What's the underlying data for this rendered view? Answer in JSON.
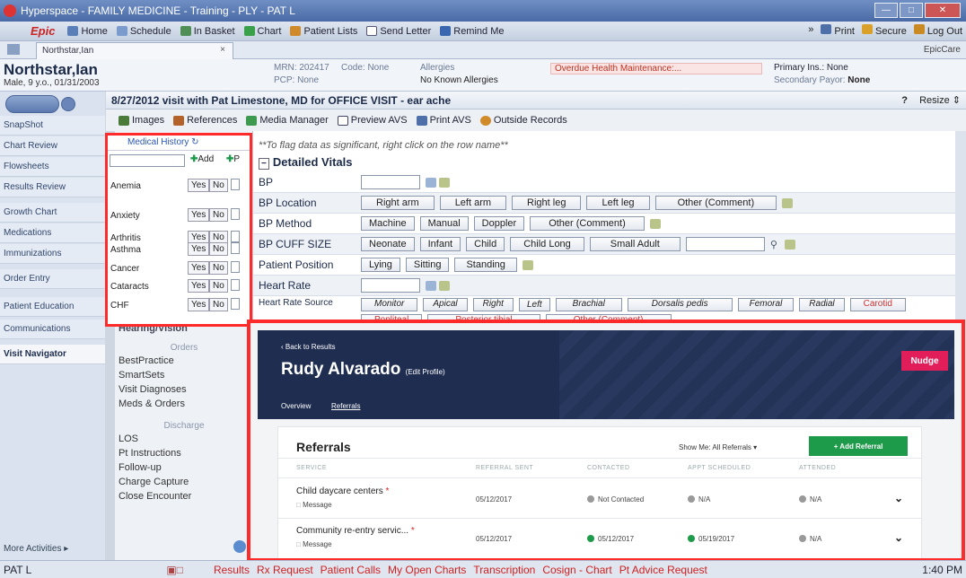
{
  "window": {
    "title": "Hyperspace - FAMILY MEDICINE - Training - PLY - PAT L"
  },
  "toolbar": {
    "brand": "Epic",
    "items": [
      "Home",
      "Schedule",
      "In Basket",
      "Chart",
      "Patient Lists",
      "Send Letter",
      "Remind Me"
    ],
    "right_items": [
      "Print",
      "Secure",
      "Log Out"
    ]
  },
  "patient_tab": {
    "label": "Northstar,Ian",
    "close": "×",
    "app_label": "EpicCare"
  },
  "patient": {
    "name": "Northstar,Ian",
    "sub": "Male, 9 y.o., 01/31/2003",
    "mrn_label": "MRN: 202417",
    "code_label": "Code: None",
    "pcp_label": "PCP: None",
    "allergies_label": "Allergies",
    "allergies_value": "No Known Allergies",
    "overdue": "Overdue Health Maintenance:...",
    "primary_ins": "Primary Ins.: None",
    "secondary_payor_label": "Secondary Payor:",
    "secondary_payor_value": "None"
  },
  "visit": {
    "title": "8/27/2012 visit with Pat Limestone, MD for OFFICE VISIT - ear ache",
    "help": "?",
    "resize": "Resize ⇕",
    "tools": [
      "Images",
      "References",
      "Media Manager",
      "Preview AVS",
      "Print AVS",
      "Outside Records"
    ]
  },
  "nav": {
    "items": [
      "SnapShot",
      "Chart Review",
      "Flowsheets",
      "Results Review",
      "Growth Chart",
      "Medications",
      "Immunizations",
      "Order Entry",
      "Patient Education",
      "Communications",
      "Visit Navigator"
    ],
    "more": "More Activities ▸"
  },
  "mid": {
    "hearing": "Hearing/Vision",
    "orders_head": "Orders",
    "orders": [
      "BestPractice",
      "SmartSets",
      "Visit Diagnoses",
      "Meds & Orders"
    ],
    "discharge_head": "Discharge",
    "discharge": [
      "LOS",
      "Pt Instructions",
      "Follow-up",
      "Charge Capture",
      "Close Encounter"
    ]
  },
  "history": {
    "title": "Medical History",
    "add_label": "Add",
    "p_label": "P",
    "yes": "Yes",
    "no": "No",
    "rows": [
      "Anemia",
      "Anxiety",
      "Arthritis",
      "Asthma",
      "Cancer",
      "Cataracts",
      "CHF"
    ]
  },
  "vitals": {
    "flag_note": "**To flag data as significant, right click on the row name**",
    "section": "Detailed Vitals",
    "bp_label": "BP",
    "bp_location_label": "BP Location",
    "bp_location_options": [
      "Right arm",
      "Left arm",
      "Right leg",
      "Left leg",
      "Other (Comment)"
    ],
    "bp_method_label": "BP Method",
    "bp_method_options": [
      "Machine",
      "Manual",
      "Doppler",
      "Other (Comment)"
    ],
    "cuff_label": "BP CUFF SIZE",
    "cuff_options": [
      "Neonate",
      "Infant",
      "Child",
      "Child Long",
      "Small Adult"
    ],
    "position_label": "Patient Position",
    "position_options": [
      "Lying",
      "Sitting",
      "Standing"
    ],
    "heart_rate_label": "Heart Rate",
    "hr_source_label": "Heart Rate Source",
    "hr_source_options": [
      "Monitor",
      "Apical",
      "Right",
      "Left",
      "Brachial",
      "Dorsalis pedis",
      "Femoral",
      "Radial"
    ],
    "hr_source_options_2": [
      "Carotid",
      "Popliteal",
      "Posterior tibial",
      "Other (Comment)"
    ]
  },
  "overlay": {
    "back": "‹ Back to Results",
    "name": "Rudy Alvarado",
    "edit": "(Edit Profile)",
    "nudge": "Nudge",
    "tabs": [
      "Overview",
      "Referrals"
    ],
    "card_title": "Referrals",
    "show_me_label": "Show Me:",
    "show_me_value": "All Referrals ▾",
    "add_button": "+ Add Referral",
    "columns": [
      "Service",
      "Referral Sent",
      "Contacted",
      "Appt Scheduled",
      "Attended"
    ],
    "rows": [
      {
        "service": "Child daycare centers",
        "sub": "Message",
        "sent": "05/12/2017",
        "contacted": "Not Contacted",
        "scheduled": "N/A",
        "attended": "N/A"
      },
      {
        "service": "Community re-entry servic...",
        "sub": "Message",
        "sent": "05/12/2017",
        "contacted": "05/12/2017",
        "scheduled": "05/19/2017",
        "attended": "N/A"
      }
    ]
  },
  "status_bar": {
    "user": "PAT L",
    "links": [
      "Results",
      "Rx Request",
      "Patient Calls",
      "My Open Charts",
      "Transcription",
      "Cosign - Chart",
      "Pt Advice Request"
    ],
    "time": "1:40 PM"
  },
  "colors": {
    "accent_red": "#ff2a2a",
    "nudge": "#e11d5a",
    "add_green": "#1d9a4a",
    "banner": "#1f2d50"
  }
}
